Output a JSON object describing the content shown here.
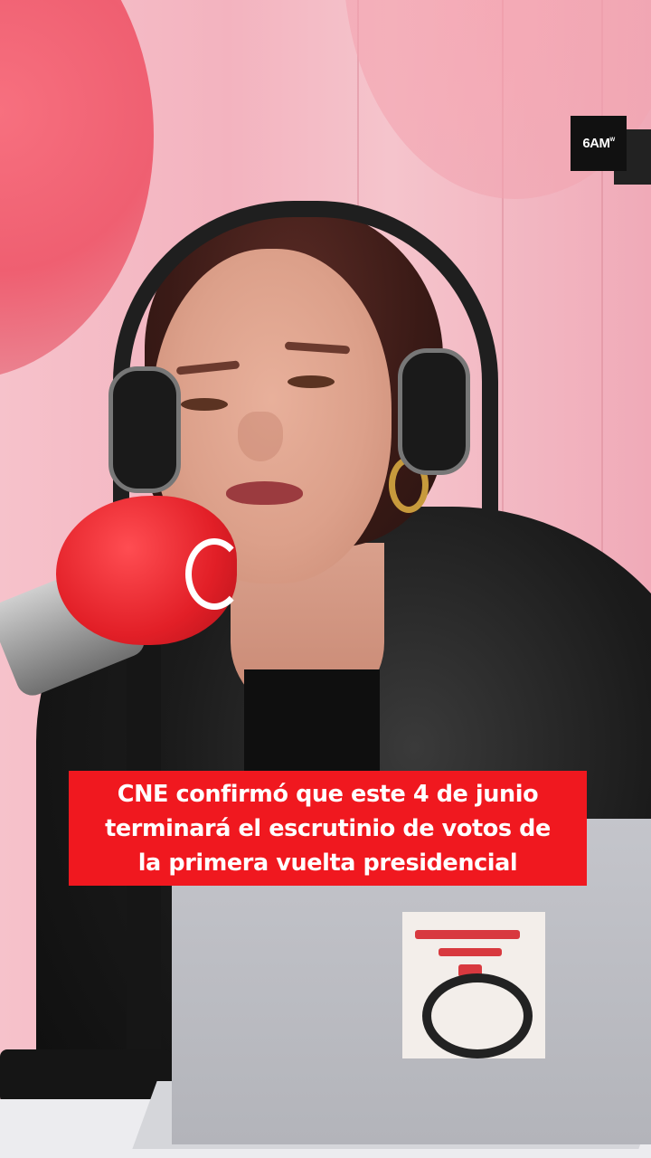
{
  "brand": {
    "logo_text": "6AM",
    "logo_superscript": "W"
  },
  "caption": {
    "lines": [
      "CNE confirmó que este 4 de junio",
      "terminará el escrutinio de votos de",
      "la primera vuelta presidencial"
    ]
  },
  "colors": {
    "caption_background": "#f0181f",
    "caption_text": "#ffffff",
    "background_wall": "#f4b9c3",
    "microphone_foam": "#e21f27",
    "badge": "#111111"
  },
  "icons": {
    "brand": "6am-logo",
    "microphone_logo": "radio-logo-icon",
    "laptop_sticker": "station-logo-icon"
  }
}
